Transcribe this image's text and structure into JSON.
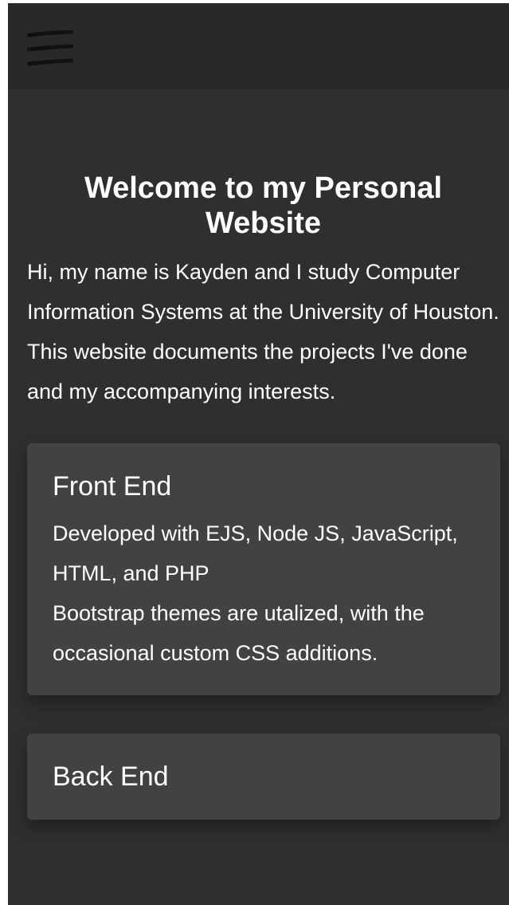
{
  "navbar": {
    "menu_icon": "hamburger-menu-icon"
  },
  "main": {
    "title": "Welcome to my Personal Website",
    "intro_line1": "Hi, my name is Kayden and I study Computer Information Systems at the University of Houston.",
    "intro_line2": "This website documents the projects I've done and my accompanying interests."
  },
  "cards": [
    {
      "title": "Front End",
      "text_line1": "Developed with EJS, Node JS, JavaScript, HTML, and PHP",
      "text_line2": "Bootstrap themes are utalized, with the occasional custom CSS additions."
    },
    {
      "title": "Back End"
    }
  ],
  "colors": {
    "navbar_bg": "#292929",
    "page_bg": "#2f2f2f",
    "card_bg": "#424242",
    "text": "#ffffff"
  }
}
